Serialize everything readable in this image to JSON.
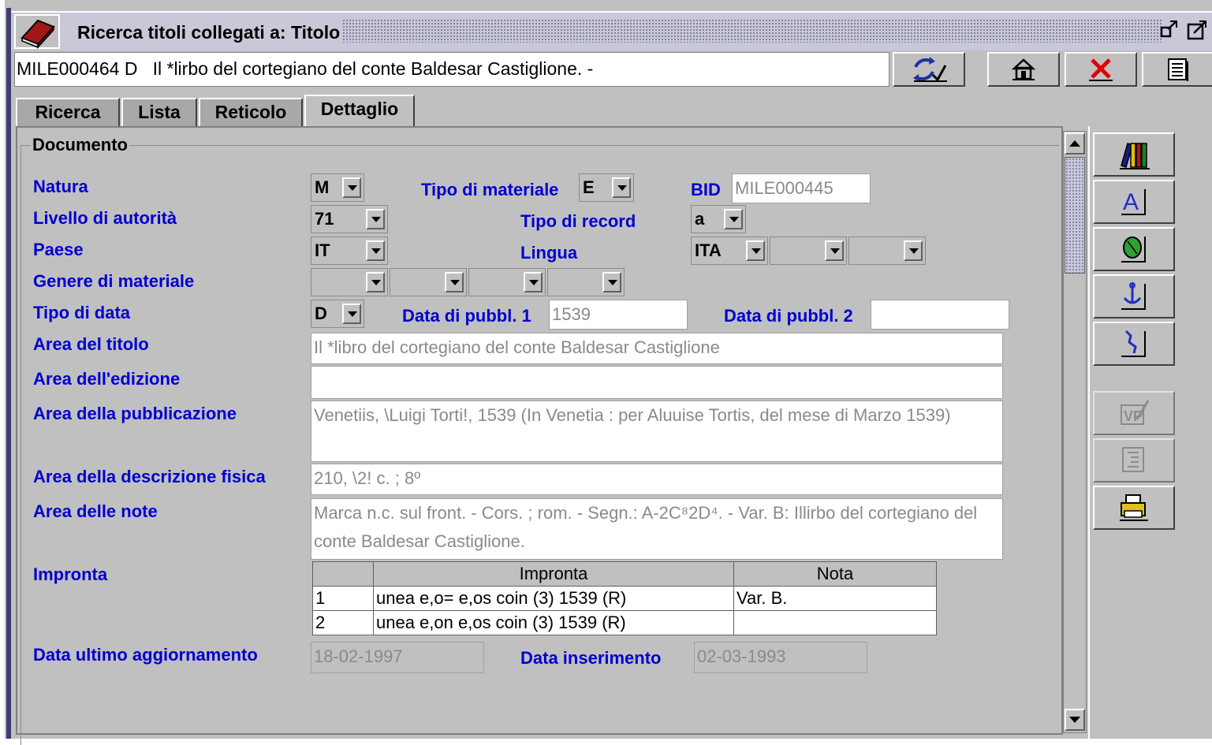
{
  "window": {
    "title": "Ricerca titoli collegati a: Titolo",
    "record_line": "MILE000464 D   Il *lirbo del cortegiano del conte Baldesar Castiglione. -"
  },
  "toolbar": {
    "refresh_icon": "refresh-check-icon",
    "home_icon": "home-icon",
    "close_icon": "close-x-icon",
    "list_icon": "list-icon"
  },
  "tabs": [
    {
      "label": "Ricerca"
    },
    {
      "label": "Lista"
    },
    {
      "label": "Reticolo"
    },
    {
      "label": "Dettaglio",
      "active": true
    }
  ],
  "group_title": "Documento",
  "labels": {
    "natura": "Natura",
    "livello": "Livello di autorità",
    "paese": "Paese",
    "genere": "Genere di materiale",
    "tipo_data": "Tipo di data",
    "area_titolo": "Area del titolo",
    "area_edizione": "Area dell'edizione",
    "area_pubblicazione": "Area della pubblicazione",
    "area_descrizione": "Area della descrizione fisica",
    "area_note": "Area delle note",
    "impronta": "Impronta",
    "data_aggiornamento": "Data ultimo aggiornamento",
    "tipo_materiale": "Tipo di materiale",
    "tipo_record": "Tipo di record",
    "lingua": "Lingua",
    "bid": "BID",
    "data_pubbl_1": "Data di pubbl. 1",
    "data_pubbl_2": "Data di pubbl. 2",
    "data_inserimento": "Data inserimento"
  },
  "values": {
    "natura": "M",
    "tipo_materiale": "E",
    "bid": "MILE000445",
    "livello": "71",
    "tipo_record": "a",
    "paese": "IT",
    "lingua_1": "ITA",
    "lingua_2": "",
    "lingua_3": "",
    "genere_1": "",
    "genere_2": "",
    "genere_3": "",
    "genere_4": "",
    "tipo_data": "D",
    "data_pubbl_1": "1539",
    "data_pubbl_2": "",
    "area_titolo": "Il *libro del cortegiano del conte Baldesar Castiglione",
    "area_edizione": "",
    "area_pubblicazione": "Venetiis, \\Luigi Torti!, 1539 (In Venetia : per Aluuise Tortis, del mese di Marzo 1539)",
    "area_descrizione": "210, \\2! c. ; 8º",
    "area_note": "Marca n.c. sul front. - Cors. ; rom. -  Segn.: A-2C⁸2D⁴. - Var. B: Illirbo del cortegiano del conte Baldesar Castiglione.",
    "data_aggiornamento": "18-02-1997",
    "data_inserimento": "02-03-1993"
  },
  "impronta_table": {
    "headers": [
      "",
      "Impronta",
      "Nota"
    ],
    "rows": [
      [
        "1",
        "unea e,o= e,os coin (3) 1539 (R)",
        "Var. B."
      ],
      [
        "2",
        "unea e,on e,os coin (3) 1539 (R)",
        ""
      ]
    ]
  },
  "side_buttons": [
    {
      "icon": "books-icon",
      "enabled": true
    },
    {
      "icon": "author-a-icon",
      "enabled": true
    },
    {
      "icon": "leaf-icon",
      "enabled": true
    },
    {
      "icon": "anchor-icon",
      "enabled": true
    },
    {
      "icon": "map-icon",
      "enabled": true
    },
    {
      "icon": "validate-icon",
      "enabled": false
    },
    {
      "icon": "tree-list-icon",
      "enabled": false
    },
    {
      "icon": "print-icon",
      "enabled": true
    }
  ]
}
